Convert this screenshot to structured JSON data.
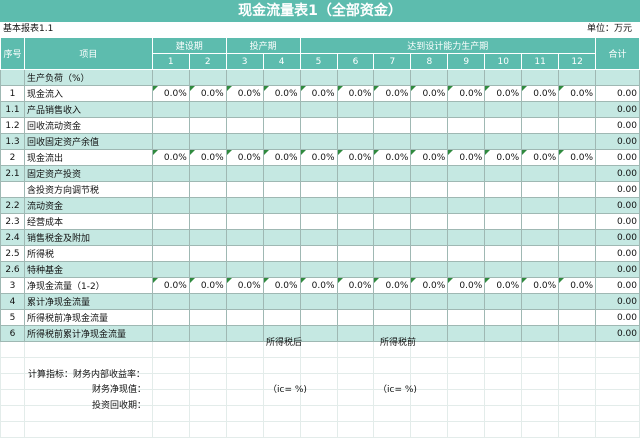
{
  "sheet": {
    "title": "现金流量表1（全部资金）",
    "report_label": "基本报表1.1",
    "unit_label": "单位：万元"
  },
  "header": {
    "seq": "序号",
    "item": "项目",
    "construction": "建设期",
    "commissioning": "投产期",
    "design": "达到设计能力生产期",
    "total": "合计",
    "periods": [
      "1",
      "2",
      "3",
      "4",
      "5",
      "6",
      "7",
      "8",
      "9",
      "10",
      "11",
      "12"
    ]
  },
  "rows": [
    {
      "seq": "",
      "label": "生产负荷（%）",
      "values": [
        "",
        "",
        "",
        "",
        "",
        "",
        "",
        "",
        "",
        "",
        "",
        ""
      ],
      "total": "",
      "shade": "alt",
      "flag": false
    },
    {
      "seq": "1",
      "label": "现金流入",
      "values": [
        "0.0%",
        "0.0%",
        "0.0%",
        "0.0%",
        "0.0%",
        "0.0%",
        "0.0%",
        "0.0%",
        "0.0%",
        "0.0%",
        "0.0%",
        "0.0%"
      ],
      "total": "0.00",
      "shade": "plain",
      "flag": true
    },
    {
      "seq": "1.1",
      "label": "产品销售收入",
      "values": [
        "",
        "",
        "",
        "",
        "",
        "",
        "",
        "",
        "",
        "",
        "",
        ""
      ],
      "total": "0.00",
      "shade": "alt",
      "flag": false
    },
    {
      "seq": "1.2",
      "label": "回收流动资金",
      "values": [
        "",
        "",
        "",
        "",
        "",
        "",
        "",
        "",
        "",
        "",
        "",
        ""
      ],
      "total": "0.00",
      "shade": "plain",
      "flag": false
    },
    {
      "seq": "1.3",
      "label": "回收固定资产余值",
      "values": [
        "",
        "",
        "",
        "",
        "",
        "",
        "",
        "",
        "",
        "",
        "",
        ""
      ],
      "total": "0.00",
      "shade": "alt",
      "flag": false
    },
    {
      "seq": "2",
      "label": "现金流出",
      "values": [
        "0.0%",
        "0.0%",
        "0.0%",
        "0.0%",
        "0.0%",
        "0.0%",
        "0.0%",
        "0.0%",
        "0.0%",
        "0.0%",
        "0.0%",
        "0.0%"
      ],
      "total": "0.00",
      "shade": "plain",
      "flag": true
    },
    {
      "seq": "2.1",
      "label": "固定资产投资",
      "values": [
        "",
        "",
        "",
        "",
        "",
        "",
        "",
        "",
        "",
        "",
        "",
        ""
      ],
      "total": "0.00",
      "shade": "alt",
      "flag": false
    },
    {
      "seq": "",
      "label": "含投资方向调节税",
      "values": [
        "",
        "",
        "",
        "",
        "",
        "",
        "",
        "",
        "",
        "",
        "",
        ""
      ],
      "total": "0.00",
      "shade": "plain",
      "flag": false
    },
    {
      "seq": "2.2",
      "label": "流动资金",
      "values": [
        "",
        "",
        "",
        "",
        "",
        "",
        "",
        "",
        "",
        "",
        "",
        ""
      ],
      "total": "0.00",
      "shade": "alt",
      "flag": false
    },
    {
      "seq": "2.3",
      "label": "经营成本",
      "values": [
        "",
        "",
        "",
        "",
        "",
        "",
        "",
        "",
        "",
        "",
        "",
        ""
      ],
      "total": "0.00",
      "shade": "plain",
      "flag": false
    },
    {
      "seq": "2.4",
      "label": "销售税金及附加",
      "values": [
        "",
        "",
        "",
        "",
        "",
        "",
        "",
        "",
        "",
        "",
        "",
        ""
      ],
      "total": "0.00",
      "shade": "alt",
      "flag": false
    },
    {
      "seq": "2.5",
      "label": "所得税",
      "values": [
        "",
        "",
        "",
        "",
        "",
        "",
        "",
        "",
        "",
        "",
        "",
        ""
      ],
      "total": "0.00",
      "shade": "plain",
      "flag": false
    },
    {
      "seq": "2.6",
      "label": "特种基金",
      "values": [
        "",
        "",
        "",
        "",
        "",
        "",
        "",
        "",
        "",
        "",
        "",
        ""
      ],
      "total": "0.00",
      "shade": "alt",
      "flag": false
    },
    {
      "seq": "3",
      "label": "净现金流量（1-2）",
      "values": [
        "0.0%",
        "0.0%",
        "0.0%",
        "0.0%",
        "0.0%",
        "0.0%",
        "0.0%",
        "0.0%",
        "0.0%",
        "0.0%",
        "0.0%",
        "0.0%"
      ],
      "total": "0.00",
      "shade": "plain",
      "flag": true
    },
    {
      "seq": "4",
      "label": "累计净现金流量",
      "values": [
        "",
        "",
        "",
        "",
        "",
        "",
        "",
        "",
        "",
        "",
        "",
        ""
      ],
      "total": "0.00",
      "shade": "alt",
      "flag": false
    },
    {
      "seq": "5",
      "label": "所得税前净现金流量",
      "values": [
        "",
        "",
        "",
        "",
        "",
        "",
        "",
        "",
        "",
        "",
        "",
        ""
      ],
      "total": "0.00",
      "shade": "plain",
      "flag": false
    },
    {
      "seq": "6",
      "label": "所得税前累计净现金流量",
      "values": [
        "",
        "",
        "",
        "",
        "",
        "",
        "",
        "",
        "",
        "",
        "",
        ""
      ],
      "total": "0.00",
      "shade": "alt",
      "flag": false
    }
  ],
  "footer": {
    "after_tax": "所得税后",
    "before_tax": "所得税前",
    "indicators_label": "计算指标：财务内部收益率：",
    "npv_label": "财务净现值：",
    "ic_after": "（ic=  %)",
    "ic_before": "（ic=  %)",
    "payback_label": "投资回收期："
  },
  "colors": {
    "header": "#5dbcae",
    "alt_row": "#c5e8e2",
    "flag": "#2f8a3e"
  }
}
